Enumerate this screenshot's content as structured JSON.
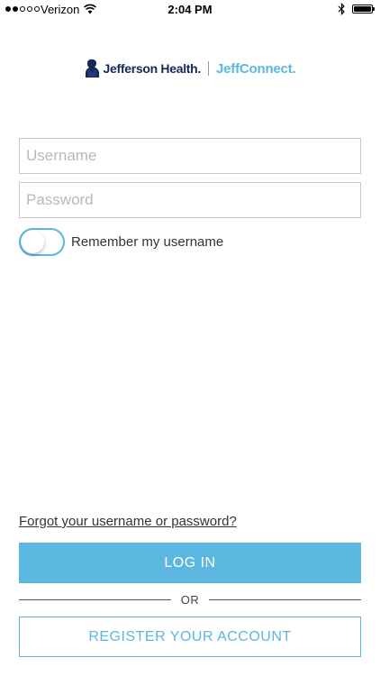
{
  "status_bar": {
    "carrier": "Verizon",
    "time": "2:04 PM",
    "signal_bars_filled": 2,
    "signal_bars_total": 5,
    "battery_level": 1.0,
    "icons": [
      "wifi-icon",
      "bluetooth-icon",
      "battery-icon"
    ]
  },
  "logo": {
    "primary": "Jefferson Health.",
    "secondary": "JeffConnect.",
    "icon": "jefferson-bust-icon",
    "colors": {
      "primary": "#13285b",
      "secondary": "#5bb7e0"
    }
  },
  "form": {
    "username_placeholder": "Username",
    "password_placeholder": "Password",
    "remember_label": "Remember my username",
    "remember_on": false
  },
  "actions": {
    "forgot_link": "Forgot your username or password?",
    "login_label": "LOG IN",
    "or_label": "OR",
    "register_label": "REGISTER YOUR ACCOUNT"
  },
  "colors": {
    "accent": "#5bb7e0",
    "border": "#c8c8c8",
    "text": "#333333"
  }
}
